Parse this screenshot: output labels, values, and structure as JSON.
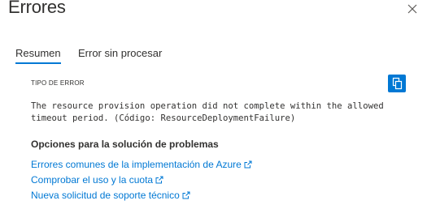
{
  "panel": {
    "title": "Errores"
  },
  "tabs": [
    {
      "label": "Resumen",
      "active": true
    },
    {
      "label": "Error sin procesar",
      "active": false
    }
  ],
  "error": {
    "section_label": "TIPO DE ERROR",
    "message": "The resource provision operation did not complete within the allowed\ntimeout period. (Código: ResourceDeploymentFailure)"
  },
  "troubleshooting": {
    "heading": "Opciones para la solución de problemas",
    "links": [
      {
        "label": "Errores comunes de la implementación de Azure"
      },
      {
        "label": "Comprobar el uso y la cuota"
      },
      {
        "label": "Nueva solicitud de soporte técnico"
      }
    ]
  },
  "icons": {
    "close": "close-icon",
    "copy": "copy-icon",
    "external": "external-link-icon"
  },
  "colors": {
    "accent": "#0078d4",
    "text": "#323130"
  }
}
